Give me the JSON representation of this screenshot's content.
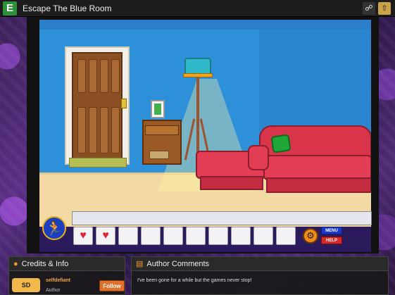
{
  "window": {
    "logo": "E",
    "title": "Escape The Blue Room",
    "share_icon": "share-icon",
    "upload_icon": "upload-icon"
  },
  "game": {
    "inventory": {
      "slots": [
        "heart",
        "heart",
        "",
        "",
        "",
        "",
        "",
        "",
        "",
        ""
      ],
      "menu_label": "MENU",
      "help_label": "HELP"
    }
  },
  "credits": {
    "title": "Credits & Info",
    "logo_text": "SD",
    "author_name": "selfdefiant",
    "author_role": "Author",
    "follow_label": "Follow"
  },
  "author_comments": {
    "title": "Author Comments",
    "text": "I've been gone for a while but the games never stop!"
  },
  "colors": {
    "wall": "#2f90da",
    "floor": "#f3d9a3",
    "sofa": "#e33e55",
    "accent": "#e0702a"
  }
}
